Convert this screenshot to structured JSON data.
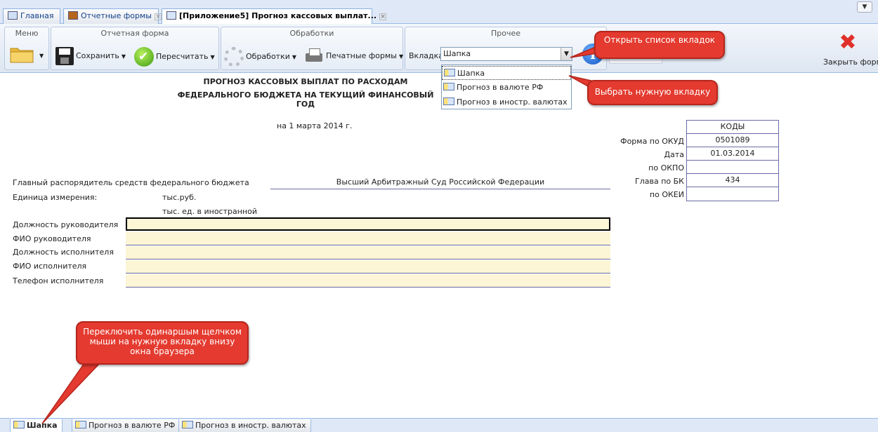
{
  "tabs": [
    {
      "label": "Главная",
      "closable": false,
      "active": false
    },
    {
      "label": "Отчетные формы",
      "closable": true,
      "active": false
    },
    {
      "label": "[Приложение5] Прогноз кассовых выплат...",
      "closable": true,
      "active": true
    }
  ],
  "ribbon": {
    "menu_title": "Меню",
    "report_title": "Отчетная форма",
    "save_label": "Сохранить",
    "recalc_label": "Пересчитать",
    "processing_title": "Обработки",
    "processing_label": "Обработки",
    "print_label": "Печатные формы",
    "other_title": "Прочее",
    "tab_select_label": "Вкладка",
    "tab_select_value": "Шапка",
    "close_label": "Закрыть форму"
  },
  "dropdown": {
    "options": [
      "Шапка",
      "Прогноз в валюте РФ",
      "Прогноз в иностр. валютах"
    ],
    "selected": "Шапка"
  },
  "document": {
    "title_line1": "ПРОГНОЗ КАССОВЫХ ВЫПЛАТ ПО РАСХОДАМ",
    "title_line2": "ФЕДЕРАЛЬНОГО БЮДЖЕТА НА ТЕКУЩИЙ ФИНАНСОВЫЙ ГОД",
    "date_line": "на 1 марта 2014 г.",
    "manager_label": "Главный распорядитель средств федерального бюджета",
    "manager_value": "Высший Арбитражный Суд Российской Федерации",
    "unit_label": "Единица измерения:",
    "unit_value1": "тыс.руб.",
    "unit_value2": "тыс. ед. в иностранной",
    "codes": {
      "header": "КОДЫ",
      "rows": [
        {
          "label": "Форма по ОКУД",
          "value": "0501089"
        },
        {
          "label": "Дата",
          "value": "01.03.2014"
        },
        {
          "label": "по ОКПО",
          "value": ""
        },
        {
          "label": "Глава по БК",
          "value": "434"
        },
        {
          "label": "по ОКЕИ",
          "value": ""
        }
      ]
    },
    "fields": [
      {
        "label": "Должность руководителя",
        "value": ""
      },
      {
        "label": "ФИО руководителя",
        "value": ""
      },
      {
        "label": "Должность исполнителя",
        "value": ""
      },
      {
        "label": "ФИО исполнителя",
        "value": ""
      },
      {
        "label": "Телефон исполнителя",
        "value": ""
      }
    ]
  },
  "bottom_tabs": [
    {
      "label": "Шапка",
      "active": true
    },
    {
      "label": "Прогноз в валюте РФ",
      "active": false
    },
    {
      "label": "Прогноз в иностр. валютах",
      "active": false
    }
  ],
  "callouts": {
    "open_list": "Открыть список вкладок",
    "choose_tab": "Выбрать нужную вкладку",
    "switch_tab": "Переключить одинаршым щелчком мыши на нужную вкладку внизу окна браузера"
  },
  "colors": {
    "callout": "#e43a2f",
    "field_fill": "#fcf5d6",
    "border_blue": "#6a6aa8"
  }
}
